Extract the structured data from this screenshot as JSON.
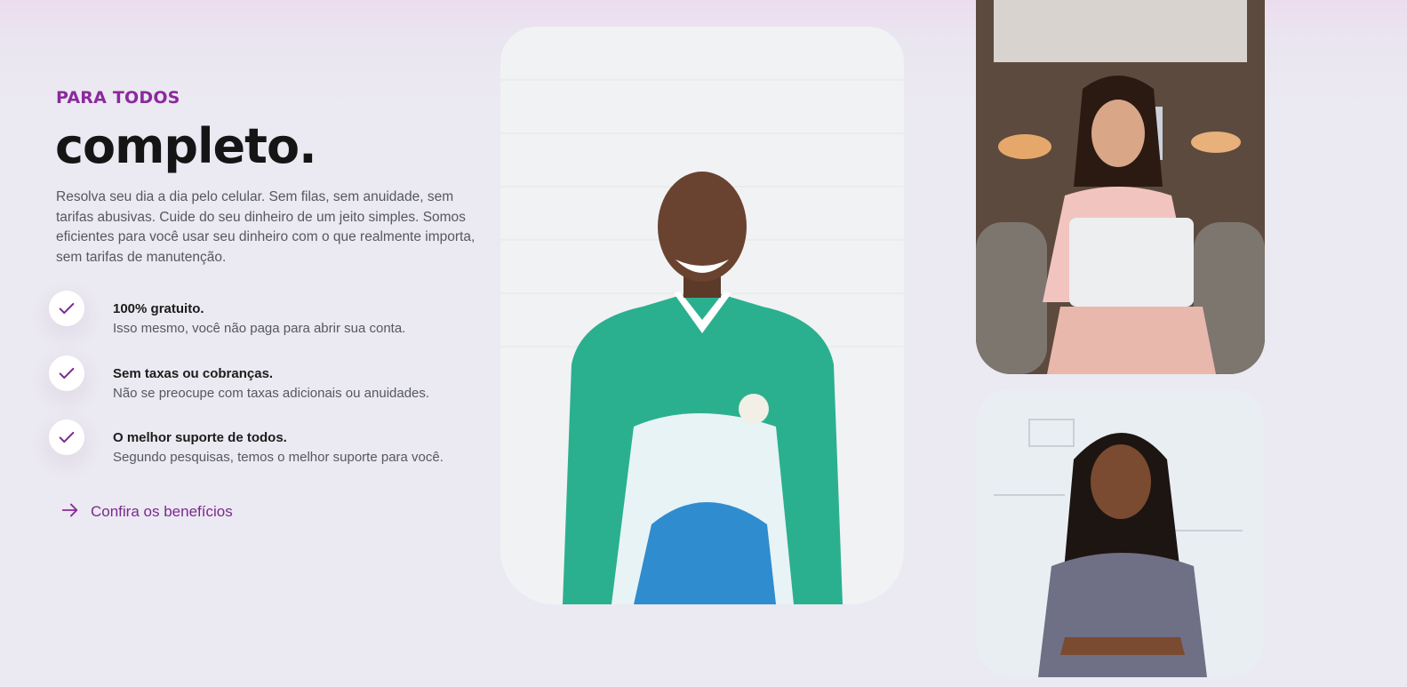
{
  "hero": {
    "eyebrow": "PARA TODOS",
    "headline": "completo.",
    "description": "Resolva seu dia a dia pelo celular. Sem filas, sem anuidade, sem tarifas abusivas. Cuide do seu dinheiro de um jeito simples. Somos eficientes para você usar seu dinheiro com o que realmente importa, sem tarifas de manutenção."
  },
  "features": [
    {
      "title": "100% gratuito.",
      "subtitle": "Isso mesmo, você não paga para abrir sua conta.",
      "icon": "check-icon"
    },
    {
      "title": "Sem taxas ou cobranças.",
      "subtitle": "Não se preocupe com taxas adicionais ou anuidades.",
      "icon": "check-icon"
    },
    {
      "title": "O melhor suporte de todos.",
      "subtitle": "Segundo pesquisas, temos o melhor suporte para você.",
      "icon": "check-icon"
    }
  ],
  "cta": {
    "label": "Confira os benefícios",
    "icon": "arrow-right-icon"
  },
  "colors": {
    "accent": "#8a2a9c",
    "heading": "#151515",
    "body": "#555862",
    "background": "#ebe9f1"
  }
}
